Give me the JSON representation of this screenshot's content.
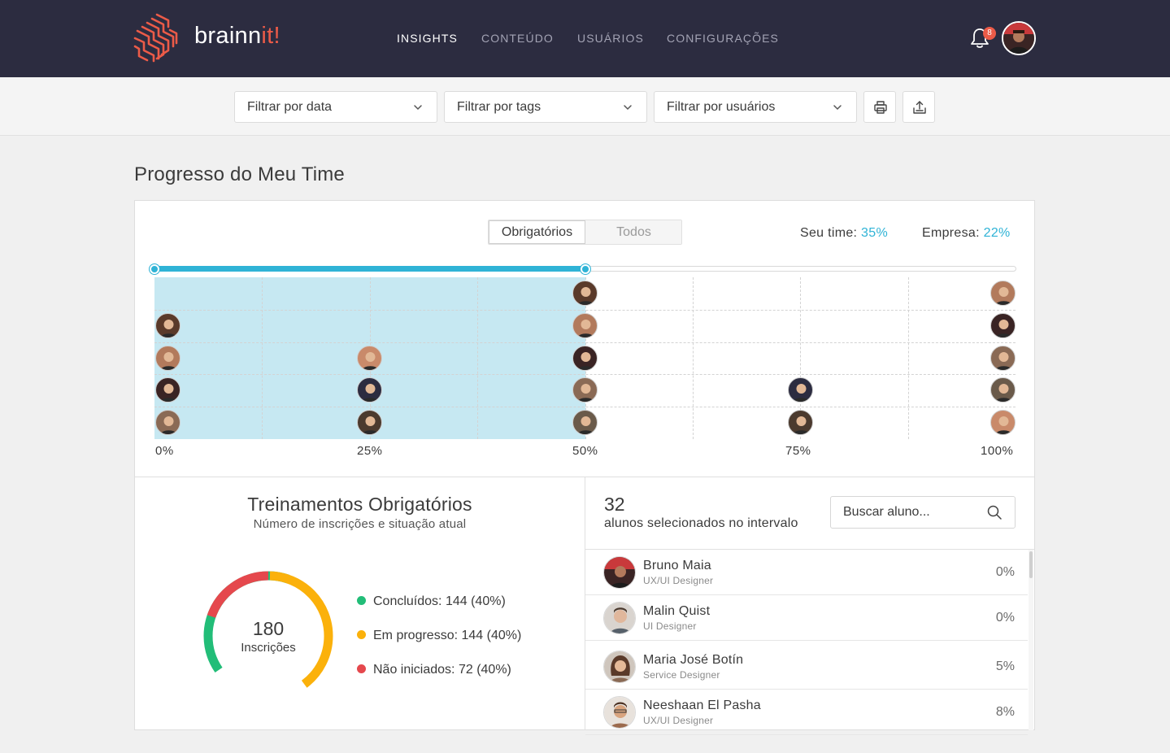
{
  "brand": {
    "name_main": "brainn",
    "name_accent": "it!",
    "accent_color": "#ec5b48",
    "bar_color": "#2c2c40"
  },
  "nav": [
    {
      "label": "INSIGHTS",
      "active": true
    },
    {
      "label": "CONTEÚDO",
      "active": false
    },
    {
      "label": "USUÁRIOS",
      "active": false
    },
    {
      "label": "CONFIGURAÇÕES",
      "active": false
    }
  ],
  "notifications": {
    "icon": "bell-icon",
    "count": "8"
  },
  "filters": {
    "date": "Filtrar por data",
    "tags": "Filtrar por tags",
    "users": "Filtrar por usuários",
    "print_icon": "print-icon",
    "export_icon": "upload-icon"
  },
  "page_title": "Progresso do Meu Time",
  "progress": {
    "tabs": [
      "Obrigatórios",
      "Todos"
    ],
    "selected_tab": "Obrigatórios",
    "team_label": "Seu time:",
    "team_value": "35%",
    "company_label": "Empresa:",
    "company_value": "22%",
    "range": [
      0,
      50
    ],
    "accent": "#2fb3d6",
    "axis_labels": [
      "0%",
      "25%",
      "50%",
      "75%",
      "100%"
    ],
    "members_by_progress": [
      {
        "progress": 0,
        "count": 4
      },
      {
        "progress": 25,
        "count": 3
      },
      {
        "progress": 50,
        "count": 5
      },
      {
        "progress": 75,
        "count": 2
      },
      {
        "progress": 100,
        "count": 5
      }
    ]
  },
  "trainings": {
    "title": "Treinamentos Obrigatórios",
    "subtitle": "Número de inscrições e situação atual",
    "total": "180",
    "total_label": "Inscrições",
    "legend": [
      {
        "label": "Concluídos:",
        "value": "144 (40%)",
        "color": "#22bd78"
      },
      {
        "label": "Em progresso:",
        "value": "144 (40%)",
        "color": "#fbb10b"
      },
      {
        "label": "Não iniciados:",
        "value": "72 (40%)",
        "color": "#e5484d"
      }
    ]
  },
  "students": {
    "count": "32",
    "count_label": "alunos selecionados no intervalo",
    "search_placeholder": "Buscar aluno...",
    "list": [
      {
        "name": "Bruno Maia",
        "role": "UX/UI Designer",
        "progress": "0%"
      },
      {
        "name": "Malin Quist",
        "role": "UI Designer",
        "progress": "0%"
      },
      {
        "name": "Maria José Botín",
        "role": "Service Designer",
        "progress": "5%"
      },
      {
        "name": "Neeshaan El Pasha",
        "role": "UX/UI Designer",
        "progress": "8%"
      }
    ]
  }
}
